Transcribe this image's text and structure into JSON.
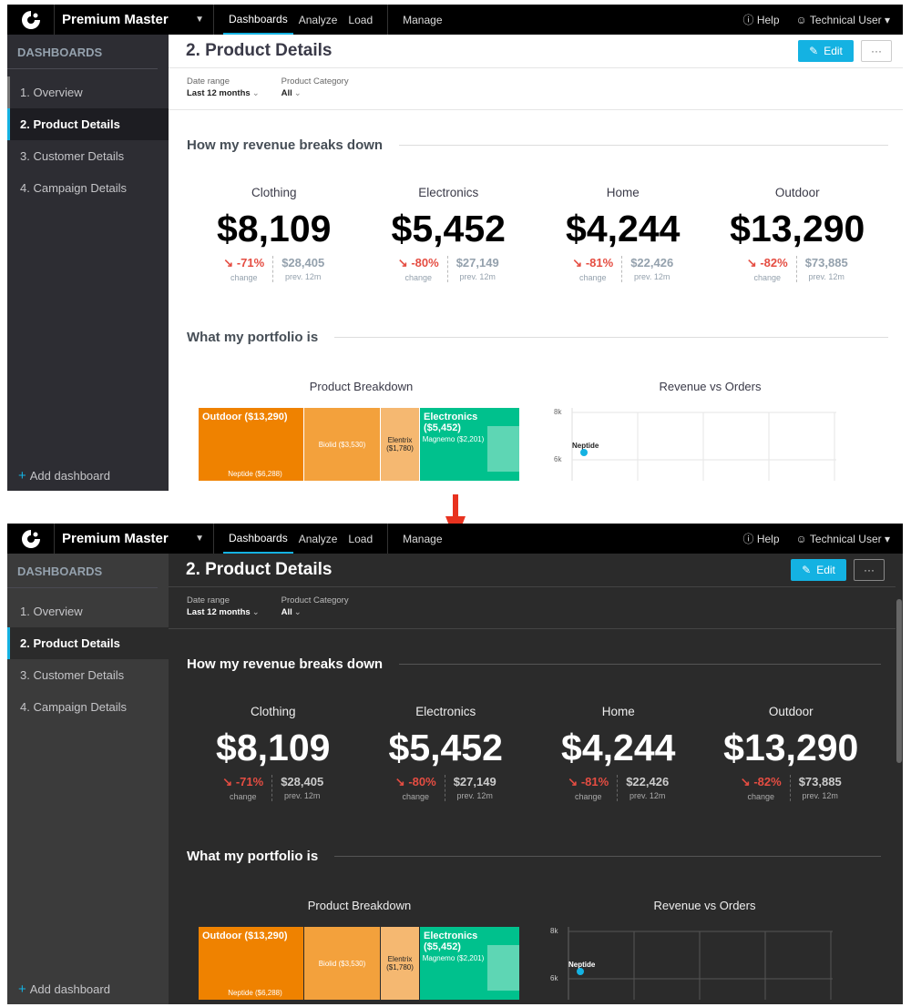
{
  "app": {
    "workspace": "Premium Master",
    "nav": [
      "Dashboards",
      "Analyze",
      "Load",
      "Manage"
    ],
    "help_label": "Help",
    "user_label": "Technical User",
    "accent": "#14b2e2"
  },
  "sidebar": {
    "heading": "DASHBOARDS",
    "items": [
      {
        "label": "1. Overview"
      },
      {
        "label": "2. Product Details"
      },
      {
        "label": "3. Customer Details"
      },
      {
        "label": "4. Campaign Details"
      }
    ],
    "add_label": "Add dashboard"
  },
  "dashboard": {
    "title": "2. Product Details",
    "edit_label": "Edit",
    "more_label": "···",
    "filters": [
      {
        "label": "Date range",
        "value": "Last 12 months"
      },
      {
        "label": "Product Category",
        "value": "All"
      }
    ],
    "section1_title": "How my revenue breaks down",
    "kpis": [
      {
        "name": "Clothing",
        "value": "$8,109",
        "change": "-71%",
        "change_label": "change",
        "prev": "$28,405",
        "prev_label": "prev. 12m"
      },
      {
        "name": "Electronics",
        "value": "$5,452",
        "change": "-80%",
        "change_label": "change",
        "prev": "$27,149",
        "prev_label": "prev. 12m"
      },
      {
        "name": "Home",
        "value": "$4,244",
        "change": "-81%",
        "change_label": "change",
        "prev": "$22,426",
        "prev_label": "prev. 12m"
      },
      {
        "name": "Outdoor",
        "value": "$13,290",
        "change": "-82%",
        "change_label": "change",
        "prev": "$73,885",
        "prev_label": "prev. 12m"
      }
    ],
    "section2_title": "What my portfolio is",
    "treemap_title": "Product Breakdown",
    "treemap": {
      "outdoor": "Outdoor ($13,290)",
      "neptide": "Neptide ($6,288)",
      "biolid": "Biolid ($3,530)",
      "elentrix": "Elentrix ($1,780)",
      "electronics": "Electronics ($5,452)",
      "magnemo": "Magnemo ($2,201)"
    },
    "scatter_title": "Revenue vs Orders",
    "scatter": {
      "ytick1": "8k",
      "ytick2": "6k",
      "point": "Neptide"
    }
  },
  "chart_data": {
    "type": "scatter",
    "title": "Revenue vs Orders",
    "yticks": [
      "8k",
      "6k"
    ],
    "points": [
      {
        "label": "Neptide"
      }
    ]
  },
  "colors": {
    "outdoor": "#ef8200",
    "outdoor_light": "#f3a13c",
    "outdoor_lighter": "#f5b871",
    "electronics": "#00c18d",
    "electronics_light": "#5ed6b4",
    "point": "#14b2e2",
    "negative": "#e54d42"
  }
}
